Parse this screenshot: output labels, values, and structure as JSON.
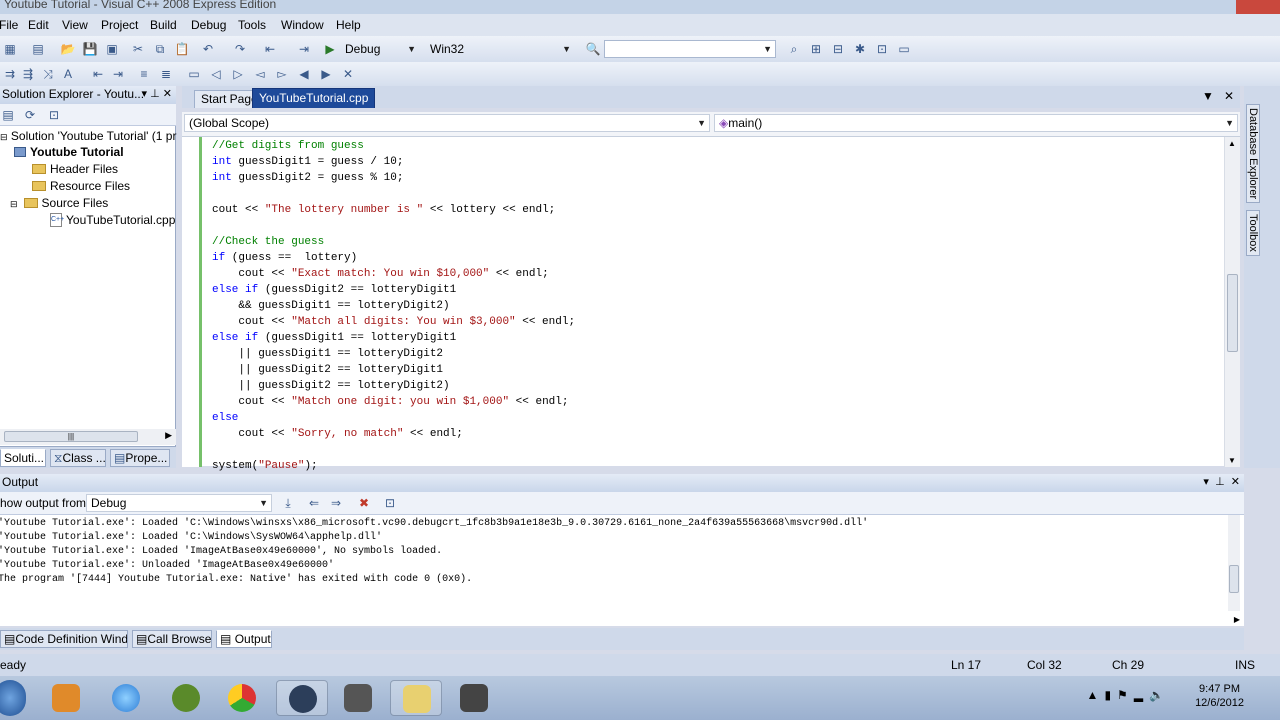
{
  "window": {
    "title": "Youtube Tutorial - Visual C++ 2008 Express Edition"
  },
  "menu": [
    "File",
    "Edit",
    "View",
    "Project",
    "Build",
    "Debug",
    "Tools",
    "Window",
    "Help"
  ],
  "toolbar": {
    "config": "Debug",
    "platform": "Win32"
  },
  "solution_explorer": {
    "title": "Solution Explorer - Youtu...",
    "solution_label": "Solution 'Youtube Tutorial' (1 pr",
    "project": "Youtube Tutorial",
    "folders": [
      "Header Files",
      "Resource Files",
      "Source Files"
    ],
    "file": "YouTubeTutorial.cpp",
    "tabs": [
      "Soluti...",
      "Class ...",
      "Prope..."
    ]
  },
  "editor": {
    "tabs": [
      "Start Page",
      "YouTubeTutorial.cpp"
    ],
    "scope": "(Global Scope)",
    "function": "main()",
    "lines": [
      [
        {
          "t": "cm",
          "v": "//Get digits from guess"
        }
      ],
      [
        {
          "t": "kw",
          "v": "int"
        },
        {
          "t": "",
          "v": " guessDigit1 = guess / 10;"
        }
      ],
      [
        {
          "t": "kw",
          "v": "int"
        },
        {
          "t": "",
          "v": " guessDigit2 = guess % 10;"
        }
      ],
      [],
      [
        {
          "t": "",
          "v": "cout << "
        },
        {
          "t": "st",
          "v": "\"The lottery number is \""
        },
        {
          "t": "",
          "v": " << lottery << endl;"
        }
      ],
      [],
      [
        {
          "t": "cm",
          "v": "//Check the guess"
        }
      ],
      [
        {
          "t": "kw",
          "v": "if"
        },
        {
          "t": "",
          "v": " (guess ==  lottery)"
        }
      ],
      [
        {
          "t": "",
          "v": "    cout << "
        },
        {
          "t": "st",
          "v": "\"Exact match: You win $10,000\""
        },
        {
          "t": "",
          "v": " << endl;"
        }
      ],
      [
        {
          "t": "kw",
          "v": "else if"
        },
        {
          "t": "",
          "v": " (guessDigit2 == lotteryDigit1"
        }
      ],
      [
        {
          "t": "",
          "v": "    && guessDigit1 == lotteryDigit2)"
        }
      ],
      [
        {
          "t": "",
          "v": "    cout << "
        },
        {
          "t": "st",
          "v": "\"Match all digits: You win $3,000\""
        },
        {
          "t": "",
          "v": " << endl;"
        }
      ],
      [
        {
          "t": "kw",
          "v": "else if"
        },
        {
          "t": "",
          "v": " (guessDigit1 == lotteryDigit1"
        }
      ],
      [
        {
          "t": "",
          "v": "    || guessDigit1 == lotteryDigit2"
        }
      ],
      [
        {
          "t": "",
          "v": "    || guessDigit2 == lotteryDigit1"
        }
      ],
      [
        {
          "t": "",
          "v": "    || guessDigit2 == lotteryDigit2)"
        }
      ],
      [
        {
          "t": "",
          "v": "    cout << "
        },
        {
          "t": "st",
          "v": "\"Match one digit: you win $1,000\""
        },
        {
          "t": "",
          "v": " << endl;"
        }
      ],
      [
        {
          "t": "kw",
          "v": "else"
        }
      ],
      [
        {
          "t": "",
          "v": "    cout << "
        },
        {
          "t": "st",
          "v": "\"Sorry, no match\""
        },
        {
          "t": "",
          "v": " << endl;"
        }
      ],
      [],
      [
        {
          "t": "",
          "v": "system("
        },
        {
          "t": "st",
          "v": "\"Pause\""
        },
        {
          "t": "",
          "v": ");"
        }
      ]
    ]
  },
  "side_tabs": [
    "Database Explorer",
    "Toolbox"
  ],
  "output": {
    "title": "Output",
    "show_from_label": "how output from:",
    "show_from_value": "Debug",
    "lines": [
      "'Youtube Tutorial.exe': Loaded 'C:\\Windows\\winsxs\\x86_microsoft.vc90.debugcrt_1fc8b3b9a1e18e3b_9.0.30729.6161_none_2a4f639a55563668\\msvcr90d.dll'",
      "'Youtube Tutorial.exe': Loaded 'C:\\Windows\\SysWOW64\\apphelp.dll'",
      "'Youtube Tutorial.exe': Loaded 'ImageAtBase0x49e60000', No symbols loaded.",
      "'Youtube Tutorial.exe': Unloaded 'ImageAtBase0x49e60000'",
      "The program '[7444] Youtube Tutorial.exe: Native' has exited with code 0 (0x0)."
    ],
    "tabs": [
      "Code Definition Window",
      "Call Browser",
      "Output"
    ]
  },
  "status": {
    "ready": "eady",
    "ln": "Ln 17",
    "col": "Col 32",
    "ch": "Ch 29",
    "mode": "INS"
  },
  "taskbar": {
    "time": "9:47 PM",
    "date": "12/6/2012"
  }
}
